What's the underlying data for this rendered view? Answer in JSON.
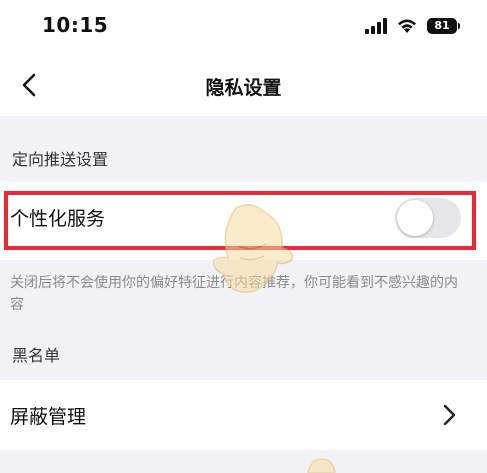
{
  "status_bar": {
    "time": "10:15",
    "battery": "81"
  },
  "nav": {
    "title": "隐私设置"
  },
  "sections": {
    "targeted_push": {
      "header": "定向推送设置",
      "personalized_service": {
        "label": "个性化服务",
        "toggle_on": false,
        "description": "关闭后将不会使用你的偏好特征进行内容推荐，你可能看到不感兴趣的内容"
      }
    },
    "blacklist": {
      "header": "黑名单",
      "block_manage": {
        "label": "屏蔽管理"
      }
    }
  },
  "colors": {
    "highlight": "#ea2a36",
    "background": "#f2f2f6"
  },
  "icons": {
    "back": "chevron-left-icon",
    "chevron": "chevron-right-icon",
    "signal": "cellular-signal-icon",
    "wifi": "wifi-icon",
    "battery": "battery-icon"
  }
}
